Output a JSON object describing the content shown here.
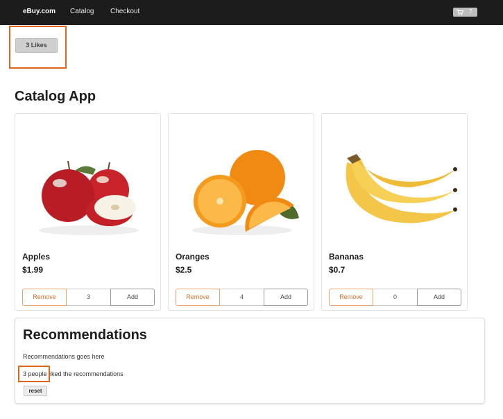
{
  "nav": {
    "brand": "eBuy.com",
    "links": [
      "Catalog",
      "Checkout"
    ],
    "cart_count": "7",
    "cart_icon": "cart-icon"
  },
  "likes_button": "3 Likes",
  "page_title": "Catalog App",
  "products": [
    {
      "name": "Apples",
      "price": "$1.99",
      "quantity": "3",
      "remove_label": "Remove",
      "add_label": "Add",
      "image_icon": "apples-image"
    },
    {
      "name": "Oranges",
      "price": "$2.5",
      "quantity": "4",
      "remove_label": "Remove",
      "add_label": "Add",
      "image_icon": "oranges-image"
    },
    {
      "name": "Bananas",
      "price": "$0.7",
      "quantity": "0",
      "remove_label": "Remove",
      "add_label": "Add",
      "image_icon": "bananas-image"
    }
  ],
  "recommendations": {
    "title": "Recommendations",
    "body": "Recommendations goes here",
    "likes_count": "3 people",
    "likes_suffix": " liked the recommendations",
    "reset_label": "reset"
  },
  "colors": {
    "navbar": "#1c1c1c",
    "highlight": "#e0641c",
    "remove_accent": "#d0702c"
  }
}
